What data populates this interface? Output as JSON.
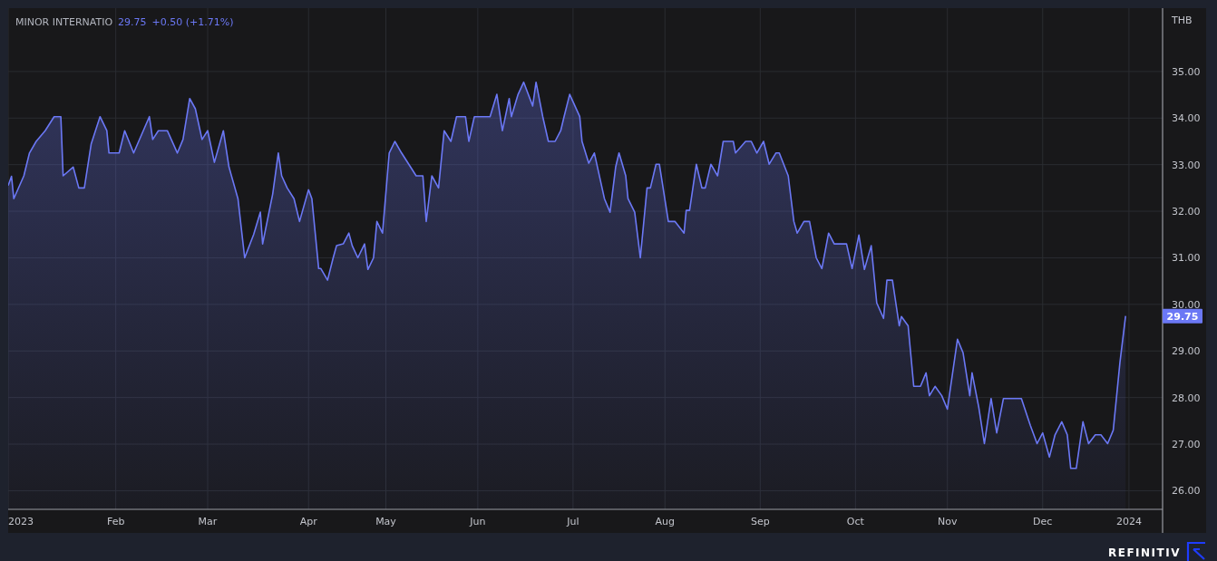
{
  "chart": {
    "legend": {
      "price": "29.75",
      "change": "+0.50 (+1.71%)"
    },
    "currency": "THB",
    "last_price_label": "29.75",
    "chart_data": {
      "type": "area",
      "grid": true,
      "xlim": [
        2023,
        2024.03
      ],
      "ylim": [
        25.6,
        36.36
      ],
      "xticks": [
        {
          "value": 2023,
          "label": "2023"
        },
        {
          "value": 2023.096,
          "label": "Feb"
        },
        {
          "value": 2023.178,
          "label": "Mar"
        },
        {
          "value": 2023.268,
          "label": "Apr"
        },
        {
          "value": 2023.337,
          "label": "May"
        },
        {
          "value": 2023.419,
          "label": "Jun"
        },
        {
          "value": 2023.504,
          "label": "Jul"
        },
        {
          "value": 2023.586,
          "label": "Aug"
        },
        {
          "value": 2023.671,
          "label": "Sep"
        },
        {
          "value": 2023.756,
          "label": "Oct"
        },
        {
          "value": 2023.838,
          "label": "Nov"
        },
        {
          "value": 2023.923,
          "label": "Dec"
        },
        {
          "value": 2024,
          "label": "2024"
        }
      ],
      "yticks": [
        {
          "value": 35,
          "label": "35.00"
        },
        {
          "value": 34,
          "label": "34.00"
        },
        {
          "value": 33,
          "label": "33.00"
        },
        {
          "value": 32,
          "label": "32.00"
        },
        {
          "value": 31,
          "label": "31.00"
        },
        {
          "value": 30,
          "label": "30.00"
        },
        {
          "value": 29,
          "label": "29.00"
        },
        {
          "value": 28,
          "label": "28.00"
        },
        {
          "value": 27,
          "label": "27.00"
        },
        {
          "value": 26,
          "label": "26.00"
        }
      ],
      "x": [
        2023.0,
        2023.003,
        2023.005,
        2023.014,
        2023.019,
        2023.025,
        2023.033,
        2023.041,
        2023.047,
        2023.049,
        2023.058,
        2023.063,
        2023.068,
        2023.074,
        2023.082,
        2023.088,
        2023.09,
        2023.099,
        2023.104,
        2023.112,
        2023.126,
        2023.129,
        2023.134,
        2023.142,
        2023.151,
        2023.156,
        2023.162,
        2023.167,
        2023.173,
        2023.178,
        2023.184,
        2023.192,
        2023.197,
        2023.205,
        2023.211,
        2023.219,
        2023.225,
        2023.227,
        2023.236,
        2023.241,
        2023.244,
        2023.249,
        2023.255,
        2023.26,
        2023.268,
        2023.271,
        2023.277,
        2023.279,
        2023.285,
        2023.29,
        2023.293,
        2023.299,
        2023.304,
        2023.307,
        2023.312,
        2023.318,
        2023.321,
        2023.326,
        2023.329,
        2023.334,
        2023.34,
        2023.345,
        2023.351,
        2023.359,
        2023.364,
        2023.37,
        2023.373,
        2023.378,
        2023.384,
        2023.389,
        2023.395,
        2023.4,
        2023.408,
        2023.411,
        2023.416,
        2023.43,
        2023.436,
        2023.441,
        2023.447,
        2023.449,
        2023.455,
        2023.46,
        2023.468,
        2023.471,
        2023.477,
        2023.482,
        2023.488,
        2023.493,
        2023.496,
        2023.501,
        2023.51,
        2023.512,
        2023.518,
        2023.523,
        2023.532,
        2023.537,
        2023.542,
        2023.545,
        2023.551,
        2023.553,
        2023.559,
        2023.564,
        2023.57,
        2023.573,
        2023.578,
        2023.581,
        2023.589,
        2023.595,
        2023.603,
        2023.605,
        2023.608,
        2023.614,
        2023.619,
        2023.622,
        2023.627,
        2023.633,
        2023.638,
        2023.647,
        2023.649,
        2023.658,
        2023.663,
        2023.668,
        2023.674,
        2023.679,
        2023.685,
        2023.688,
        2023.696,
        2023.701,
        2023.704,
        2023.71,
        2023.715,
        2023.721,
        2023.726,
        2023.732,
        2023.737,
        2023.742,
        2023.748,
        2023.753,
        2023.759,
        2023.764,
        2023.77,
        2023.775,
        2023.781,
        2023.784,
        2023.789,
        2023.795,
        2023.797,
        2023.803,
        2023.808,
        2023.814,
        2023.819,
        2023.822,
        2023.827,
        2023.833,
        2023.838,
        2023.847,
        2023.852,
        2023.858,
        2023.86,
        2023.866,
        2023.871,
        2023.877,
        2023.882,
        2023.888,
        2023.899,
        2023.904,
        2023.912,
        2023.918,
        2023.923,
        2023.929,
        2023.934,
        2023.94,
        2023.945,
        2023.948,
        2023.953,
        2023.959,
        2023.964,
        2023.97,
        2023.975,
        2023.981,
        2023.986,
        2023.992,
        2023.997
      ],
      "series": [
        {
          "name": "MINOR INTERNATIO",
          "color": "#6b78f5",
          "values": [
            32.55,
            32.75,
            32.27,
            32.76,
            33.25,
            33.5,
            33.73,
            34.03,
            34.03,
            32.76,
            32.95,
            32.5,
            32.5,
            33.44,
            34.03,
            33.73,
            33.25,
            33.25,
            33.73,
            33.25,
            34.03,
            33.54,
            33.73,
            33.73,
            33.25,
            33.54,
            34.42,
            34.2,
            33.54,
            33.73,
            33.05,
            33.73,
            32.95,
            32.27,
            31.0,
            31.5,
            31.98,
            31.3,
            32.37,
            33.25,
            32.76,
            32.5,
            32.27,
            31.78,
            32.46,
            32.27,
            30.77,
            30.77,
            30.52,
            31.0,
            31.26,
            31.3,
            31.53,
            31.26,
            31.0,
            31.3,
            30.75,
            31.0,
            31.78,
            31.53,
            33.25,
            33.5,
            33.25,
            32.95,
            32.76,
            32.76,
            31.78,
            32.76,
            32.5,
            33.73,
            33.5,
            34.03,
            34.03,
            33.5,
            34.03,
            34.03,
            34.51,
            33.73,
            34.42,
            34.03,
            34.51,
            34.77,
            34.26,
            34.77,
            34.03,
            33.5,
            33.5,
            33.73,
            34.03,
            34.51,
            34.03,
            33.5,
            33.03,
            33.25,
            32.27,
            31.98,
            32.95,
            33.25,
            32.76,
            32.27,
            31.98,
            31.0,
            32.5,
            32.5,
            33.01,
            33.01,
            31.78,
            31.78,
            31.53,
            32.02,
            32.02,
            33.01,
            32.5,
            32.5,
            33.01,
            32.76,
            33.5,
            33.5,
            33.25,
            33.5,
            33.5,
            33.25,
            33.5,
            33.01,
            33.25,
            33.25,
            32.76,
            31.78,
            31.53,
            31.78,
            31.78,
            31.0,
            30.77,
            31.53,
            31.3,
            31.3,
            31.3,
            30.77,
            31.49,
            30.75,
            31.26,
            30.03,
            29.7,
            30.52,
            30.52,
            29.54,
            29.74,
            29.54,
            28.24,
            28.24,
            28.53,
            28.04,
            28.24,
            28.04,
            27.75,
            29.25,
            28.96,
            28.04,
            28.53,
            27.79,
            27.01,
            27.98,
            27.24,
            27.98,
            27.98,
            27.98,
            27.4,
            27.01,
            27.24,
            26.72,
            27.2,
            27.48,
            27.2,
            26.48,
            26.48,
            27.48,
            27.01,
            27.2,
            27.2,
            27.01,
            27.3,
            28.76,
            29.75
          ]
        }
      ]
    }
  },
  "brand": {
    "name": "REFINITIV"
  }
}
